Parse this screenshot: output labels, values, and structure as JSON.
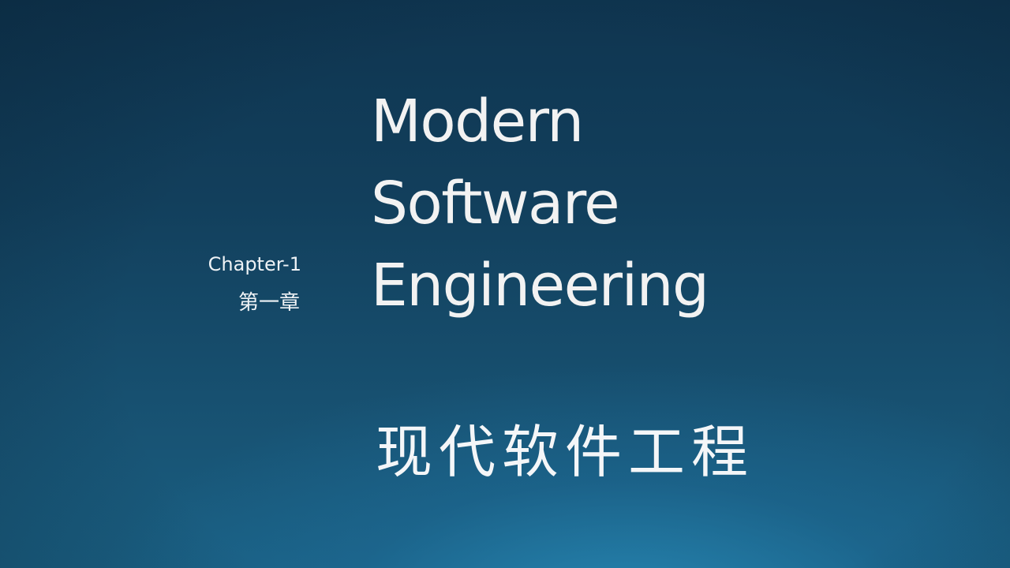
{
  "slide": {
    "title_lines": [
      "Modern",
      "Software",
      "Engineering"
    ],
    "chapter_label": "Chapter-1",
    "chapter_label_cn": "第一章",
    "subtitle_cn": "现代软件工程"
  },
  "colors": {
    "background_top": "#0f3550",
    "background_bottom": "#1a5f82",
    "text": "#f2f2f2"
  }
}
